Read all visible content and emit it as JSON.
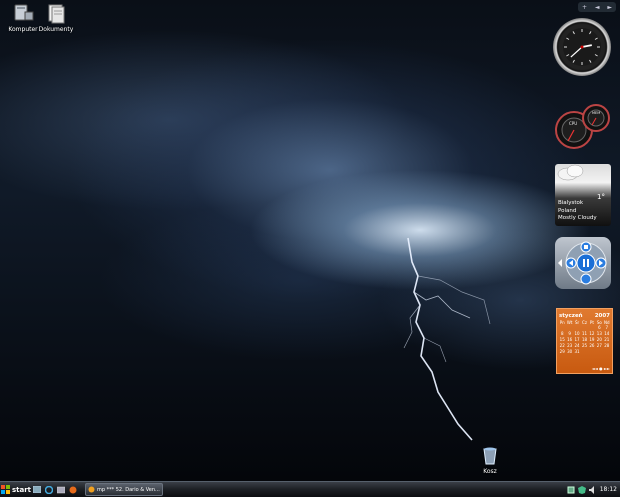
{
  "desktop": {
    "icons": [
      {
        "label": "Komputer",
        "icon": "computer-icon"
      },
      {
        "label": "Dokumenty",
        "icon": "documents-folder-icon"
      },
      {
        "label": "Kosz",
        "icon": "recycle-bin-icon"
      }
    ]
  },
  "sidebar": {
    "nav": {
      "add": "+",
      "prev": "◄",
      "next": "►"
    },
    "clock": {
      "hours": 2,
      "minutes": 38
    },
    "meters": {
      "cpu_label": "CPU",
      "mem_label": "MEM"
    },
    "weather": {
      "temperature": "1°",
      "city": "Bialystok",
      "country": "Poland",
      "condition": "Mostly Cloudy"
    },
    "calendar": {
      "month": "styczeń",
      "year": "2007",
      "days": [
        "Pn",
        "Wt",
        "Śr",
        "Cz",
        "Pt",
        "So",
        "Nd"
      ],
      "dates": [
        "",
        "",
        "",
        "",
        "",
        "6",
        "7",
        "8",
        "9",
        "10",
        "11",
        "12",
        "13",
        "14",
        "15",
        "16",
        "17",
        "18",
        "19",
        "20",
        "21",
        "22",
        "23",
        "24",
        "25",
        "26",
        "27",
        "28",
        "29",
        "30",
        "31",
        "",
        "",
        "",
        ""
      ]
    }
  },
  "taskbar": {
    "start_label": "start",
    "task_label": "mp *** 52. Dario & Ven...",
    "time": "18:12"
  }
}
